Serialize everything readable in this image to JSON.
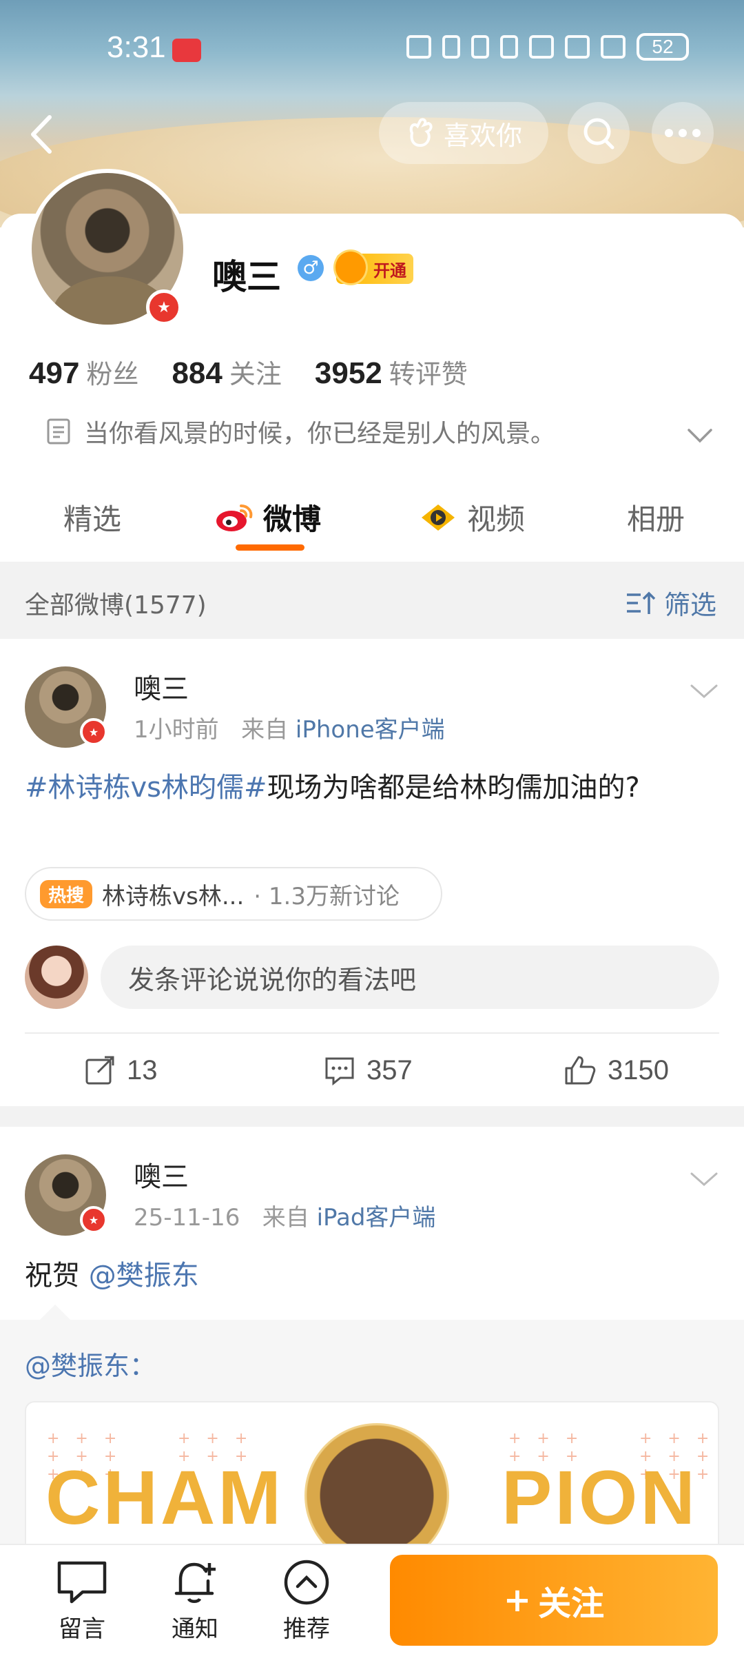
{
  "status_bar": {
    "time": "3:31",
    "battery": "52"
  },
  "header": {
    "like_label": "喜欢你"
  },
  "profile": {
    "name": "噢三",
    "gender": "♂",
    "vip_label": "开通",
    "stats": [
      {
        "num": "497",
        "label": "粉丝"
      },
      {
        "num": "884",
        "label": "关注"
      },
      {
        "num": "3952",
        "label": "转评赞"
      }
    ],
    "bio": "当你看风景的时候，你已经是别人的风景。"
  },
  "tabs": [
    {
      "label": "精选",
      "icon": "none"
    },
    {
      "label": "微博",
      "icon": "weibo-logo-icon",
      "active": true
    },
    {
      "label": "视频",
      "icon": "video-icon"
    },
    {
      "label": "相册",
      "icon": "none"
    }
  ],
  "filter_bar": {
    "all_label": "全部微博(1577)",
    "filter_label": "筛选"
  },
  "posts": [
    {
      "name": "噢三",
      "time": "1小时前",
      "from": "来自",
      "source": "iPhone客户端",
      "tag": "#林诗栋vs林昀儒#",
      "text": "现场为啥都是给林昀儒加油的?",
      "hot_badge": "热搜",
      "hot_topic": "林诗栋vs林...",
      "hot_count": "· 1.3万新讨论",
      "comment_placeholder": "发条评论说说你的看法吧",
      "reposts": "13",
      "comments": "357",
      "likes": "3150"
    },
    {
      "name": "噢三",
      "time": "25-11-16",
      "from": "来自",
      "source": "iPad客户端",
      "text_prefix": "祝贺",
      "mention": "@樊振东",
      "repost_user": "@樊振东：",
      "image_word_left": "CHAM",
      "image_word_right": "PION"
    }
  ],
  "bottom_bar": {
    "items": [
      "留言",
      "通知",
      "推荐"
    ],
    "follow_label": "关注",
    "follow_plus": "+"
  },
  "colors": {
    "accent": "#ff8a00",
    "link": "#4c76b0",
    "vip_red": "#c0181e"
  }
}
